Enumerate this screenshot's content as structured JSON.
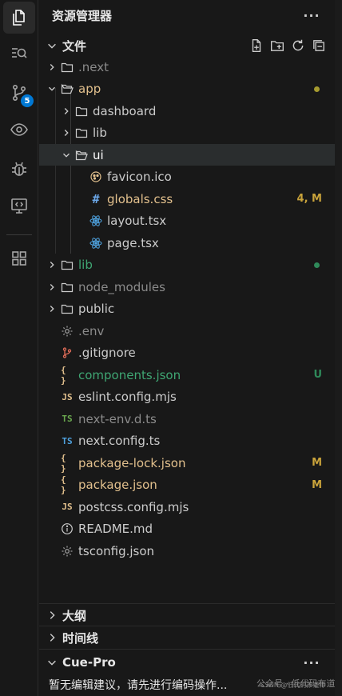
{
  "activity_bar": {
    "items": [
      {
        "icon": "files-icon",
        "active": true
      },
      {
        "icon": "search-icon"
      },
      {
        "icon": "source-control-icon",
        "badge": "5"
      },
      {
        "icon": "eye-icon"
      },
      {
        "icon": "debug-icon"
      },
      {
        "icon": "remote-explorer-icon"
      },
      {
        "icon": "extensions-icon"
      }
    ]
  },
  "explorer": {
    "title": "资源管理器",
    "more": "···",
    "folder_section": "文件",
    "actions": [
      "new-file-icon",
      "new-folder-icon",
      "refresh-icon",
      "collapse-all-icon"
    ],
    "tree": [
      {
        "label": ".next",
        "type": "folder",
        "expanded": false,
        "depth": 0,
        "color": "#8b8b8b"
      },
      {
        "label": "app",
        "type": "folder",
        "expanded": true,
        "depth": 0,
        "color": "#e2c08d",
        "dot": "#a59a2f"
      },
      {
        "label": "dashboard",
        "type": "folder",
        "expanded": false,
        "depth": 1,
        "color": "#cccccc"
      },
      {
        "label": "lib",
        "type": "folder",
        "expanded": false,
        "depth": 1,
        "color": "#cccccc"
      },
      {
        "label": "ui",
        "type": "folder",
        "expanded": true,
        "depth": 1,
        "color": "#ffffff",
        "selected": true
      },
      {
        "label": "favicon.ico",
        "type": "favicon",
        "depth": 2,
        "color": "#cccccc"
      },
      {
        "label": "globals.css",
        "type": "css",
        "depth": 2,
        "color": "#e2c08d",
        "decoration": "4, M",
        "decoration_color": "#c9a33b"
      },
      {
        "label": "layout.tsx",
        "type": "react",
        "depth": 2,
        "color": "#cccccc"
      },
      {
        "label": "page.tsx",
        "type": "react",
        "depth": 2,
        "color": "#cccccc"
      },
      {
        "label": "lib",
        "type": "folder",
        "expanded": false,
        "depth": 0,
        "color": "#3fa673",
        "dot": "#2f8a5a"
      },
      {
        "label": "node_modules",
        "type": "folder",
        "expanded": false,
        "depth": 0,
        "color": "#8b8b8b"
      },
      {
        "label": "public",
        "type": "folder",
        "expanded": false,
        "depth": 0,
        "color": "#cccccc"
      },
      {
        "label": ".env",
        "type": "gear",
        "depth": 0,
        "color": "#8b8b8b"
      },
      {
        "label": ".gitignore",
        "type": "git",
        "depth": 0,
        "color": "#cccccc"
      },
      {
        "label": "components.json",
        "type": "json",
        "depth": 0,
        "color": "#3fa673",
        "decoration": "U",
        "decoration_color": "#2f8a5a"
      },
      {
        "label": "eslint.config.mjs",
        "type": "js",
        "depth": 0,
        "color": "#cccccc"
      },
      {
        "label": "next-env.d.ts",
        "type": "ts-green",
        "depth": 0,
        "color": "#8b8b8b"
      },
      {
        "label": "next.config.ts",
        "type": "ts",
        "depth": 0,
        "color": "#cccccc"
      },
      {
        "label": "package-lock.json",
        "type": "json",
        "depth": 0,
        "color": "#e2c08d",
        "decoration": "M",
        "decoration_color": "#c9a33b"
      },
      {
        "label": "package.json",
        "type": "json",
        "depth": 0,
        "color": "#e2c08d",
        "decoration": "M",
        "decoration_color": "#c9a33b"
      },
      {
        "label": "postcss.config.mjs",
        "type": "js",
        "depth": 0,
        "color": "#cccccc"
      },
      {
        "label": "README.md",
        "type": "info",
        "depth": 0,
        "color": "#cccccc"
      },
      {
        "label": "tsconfig.json",
        "type": "gear",
        "depth": 0,
        "color": "#cccccc"
      }
    ]
  },
  "outline": {
    "label": "大纲"
  },
  "timeline": {
    "label": "时间线"
  },
  "cue_pro": {
    "label": "Cue-Pro",
    "more": "···",
    "message": "暂无编辑建议，请先进行编码操作..."
  },
  "watermark": {
    "text": "公众号 · 低代码布道师",
    "sub": "CSDN @低代码布道师"
  }
}
